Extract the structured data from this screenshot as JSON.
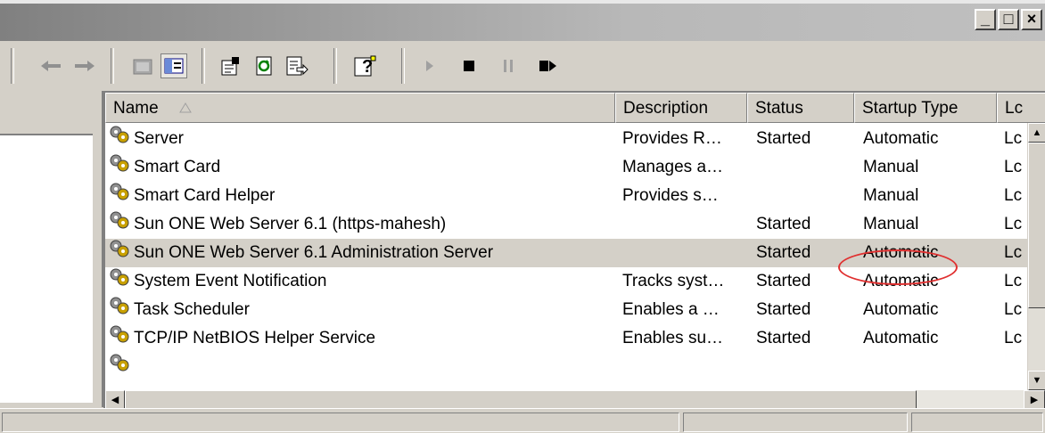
{
  "window": {
    "minimize_glyph": "_",
    "maximize_glyph": "□",
    "close_glyph": "×"
  },
  "toolbar": {
    "buttons": [
      "back-arrow-icon",
      "forward-arrow-icon",
      "up-folder-icon",
      "show-hide-tree-icon",
      "properties-icon",
      "refresh-icon",
      "export-list-icon",
      "help-icon",
      "start-service-icon",
      "stop-service-icon",
      "pause-service-icon",
      "restart-service-icon"
    ]
  },
  "columns": {
    "name": "Name",
    "description": "Description",
    "status": "Status",
    "startup_type": "Startup Type",
    "log_on_as": "Lc"
  },
  "services": [
    {
      "name": "Server",
      "description": "Provides R…",
      "status": "Started",
      "startup": "Automatic",
      "logon": "Lc"
    },
    {
      "name": "Smart Card",
      "description": "Manages a…",
      "status": "",
      "startup": "Manual",
      "logon": "Lc"
    },
    {
      "name": "Smart Card Helper",
      "description": "Provides s…",
      "status": "",
      "startup": "Manual",
      "logon": "Lc"
    },
    {
      "name": "Sun ONE Web Server 6.1 (https-mahesh)",
      "description": "",
      "status": "Started",
      "startup": "Manual",
      "logon": "Lc"
    },
    {
      "name": "Sun ONE Web Server 6.1 Administration Server",
      "description": "",
      "status": "Started",
      "startup": "Automatic",
      "logon": "Lc"
    },
    {
      "name": "System Event Notification",
      "description": "Tracks syst…",
      "status": "Started",
      "startup": "Automatic",
      "logon": "Lc"
    },
    {
      "name": "Task Scheduler",
      "description": "Enables a …",
      "status": "Started",
      "startup": "Automatic",
      "logon": "Lc"
    },
    {
      "name": "TCP/IP NetBIOS Helper Service",
      "description": "Enables su…",
      "status": "Started",
      "startup": "Automatic",
      "logon": "Lc"
    }
  ],
  "selected_row": 4,
  "annotation_color": "#e03030"
}
